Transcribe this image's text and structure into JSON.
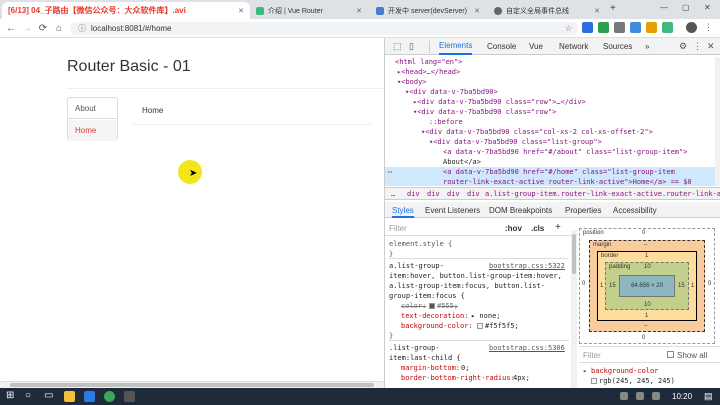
{
  "browser": {
    "tabs": [
      {
        "label": "[6/13] 04_子路由【微信公众号：大众软件库】.avi"
      },
      {
        "label": "介绍 | Vue Router"
      },
      {
        "label": "开发中 server(devServer)"
      },
      {
        "label": "自定义全局事件总线"
      }
    ],
    "new_tab_label": "+",
    "address": "localhost:8081/#/home",
    "nav": {
      "back": "←",
      "forward": "→",
      "reload": "⟳",
      "home": "⌂"
    }
  },
  "page": {
    "title": "Router Basic - 01",
    "list_items": [
      {
        "label": "About"
      },
      {
        "label": "Home"
      }
    ],
    "content": "Home"
  },
  "devtools": {
    "tabs": [
      "Elements",
      "Console",
      "Vue",
      "Network",
      "Sources",
      "»"
    ],
    "dom_lines": [
      {
        "text": "<html lang=\"en\">"
      },
      {
        "text": "▸<head>…</head>"
      },
      {
        "text": "▾<body>"
      },
      {
        "text": "▾<div data-v-7ba5bd90>"
      },
      {
        "text": "▸<div data-v-7ba5bd90 class=\"row\">…</div>"
      },
      {
        "text": "▾<div data-v-7ba5bd90 class=\"row\">"
      },
      {
        "text": "::before"
      },
      {
        "text": "▾<div data-v-7ba5bd90 class=\"col-xs-2 col-xs-offset-2\">"
      },
      {
        "text": "▾<div data-v-7ba5bd90 class=\"list-group\">"
      },
      {
        "text": "<a data-v-7ba5bd90 href=\"#/about\" class=\"list-group-item\">"
      },
      {
        "text": "About</a>"
      },
      {
        "text": "<a data-v-7ba5bd90 href=\"#/home\" class=\"list-group-item"
      },
      {
        "text": "router-link-exact-active router-link-active\">Home</a> == $0"
      }
    ],
    "breadcrumb": [
      "…",
      "div",
      "div",
      "div",
      "div",
      "a.list-group-item.router-link-exact-active.router-link-active"
    ],
    "panel_tabs": [
      "Styles",
      "Event Listeners",
      "DOM Breakpoints",
      "Properties",
      "Accessibility"
    ],
    "filter_placeholder": "Filter",
    "hov": ":hov",
    "cls": ".cls",
    "add": "+",
    "rules": {
      "r0_selector": "element.style {",
      "r0_close": "}",
      "r1_selector_a": "a.list-group-",
      "r1_source": "bootstrap.css:5322",
      "r1_selector_b": "item:hover, button.list-group-item:hover,",
      "r1_selector_c": "a.list-group-item:focus, button.list-",
      "r1_selector_d": "group-item:focus {",
      "r1_p1": "color:",
      "r1_v1": "#555;",
      "r1_p2": "text-decoration:",
      "r1_v2": "▸ none;",
      "r1_p3": "background-color:",
      "r1_v3": "#f5f5f5;",
      "r1_close": "}",
      "r2_selector_a": ".list-group-",
      "r2_source": "bootstrap.css:5306",
      "r2_selector_b": "item:last-child {",
      "r2_p1": "margin-bottom:",
      "r2_v1": "0;",
      "r2_p2": "border-bottom-right-radius:",
      "r2_v2": "4px;"
    },
    "box_model": {
      "position_label": "position",
      "position_value": "0",
      "margin_label": "margin",
      "margin_value": "–",
      "border_label": "border",
      "border_value": "1",
      "padding_label": "padding",
      "padding_value": "10",
      "content": "64.656 × 20",
      "left_outer": "0",
      "left_border": "1",
      "left_padding": "15",
      "right_padding": "15",
      "right_border": "1",
      "right_outer": "0",
      "bottom_padding": "10",
      "bottom_border": "1",
      "bottom_margin": "–",
      "bottom_position": "0"
    },
    "computed_filter": "Filter",
    "show_all": "Show all",
    "computed_prop": "background-color",
    "computed_val": "rgb(245, 245, 245)"
  },
  "taskbar": {
    "time": "10:20"
  },
  "colors": {
    "router_active": "#e0392b",
    "highlight_row": "#cfe8fc",
    "cursor_circle": "#f2e200"
  }
}
